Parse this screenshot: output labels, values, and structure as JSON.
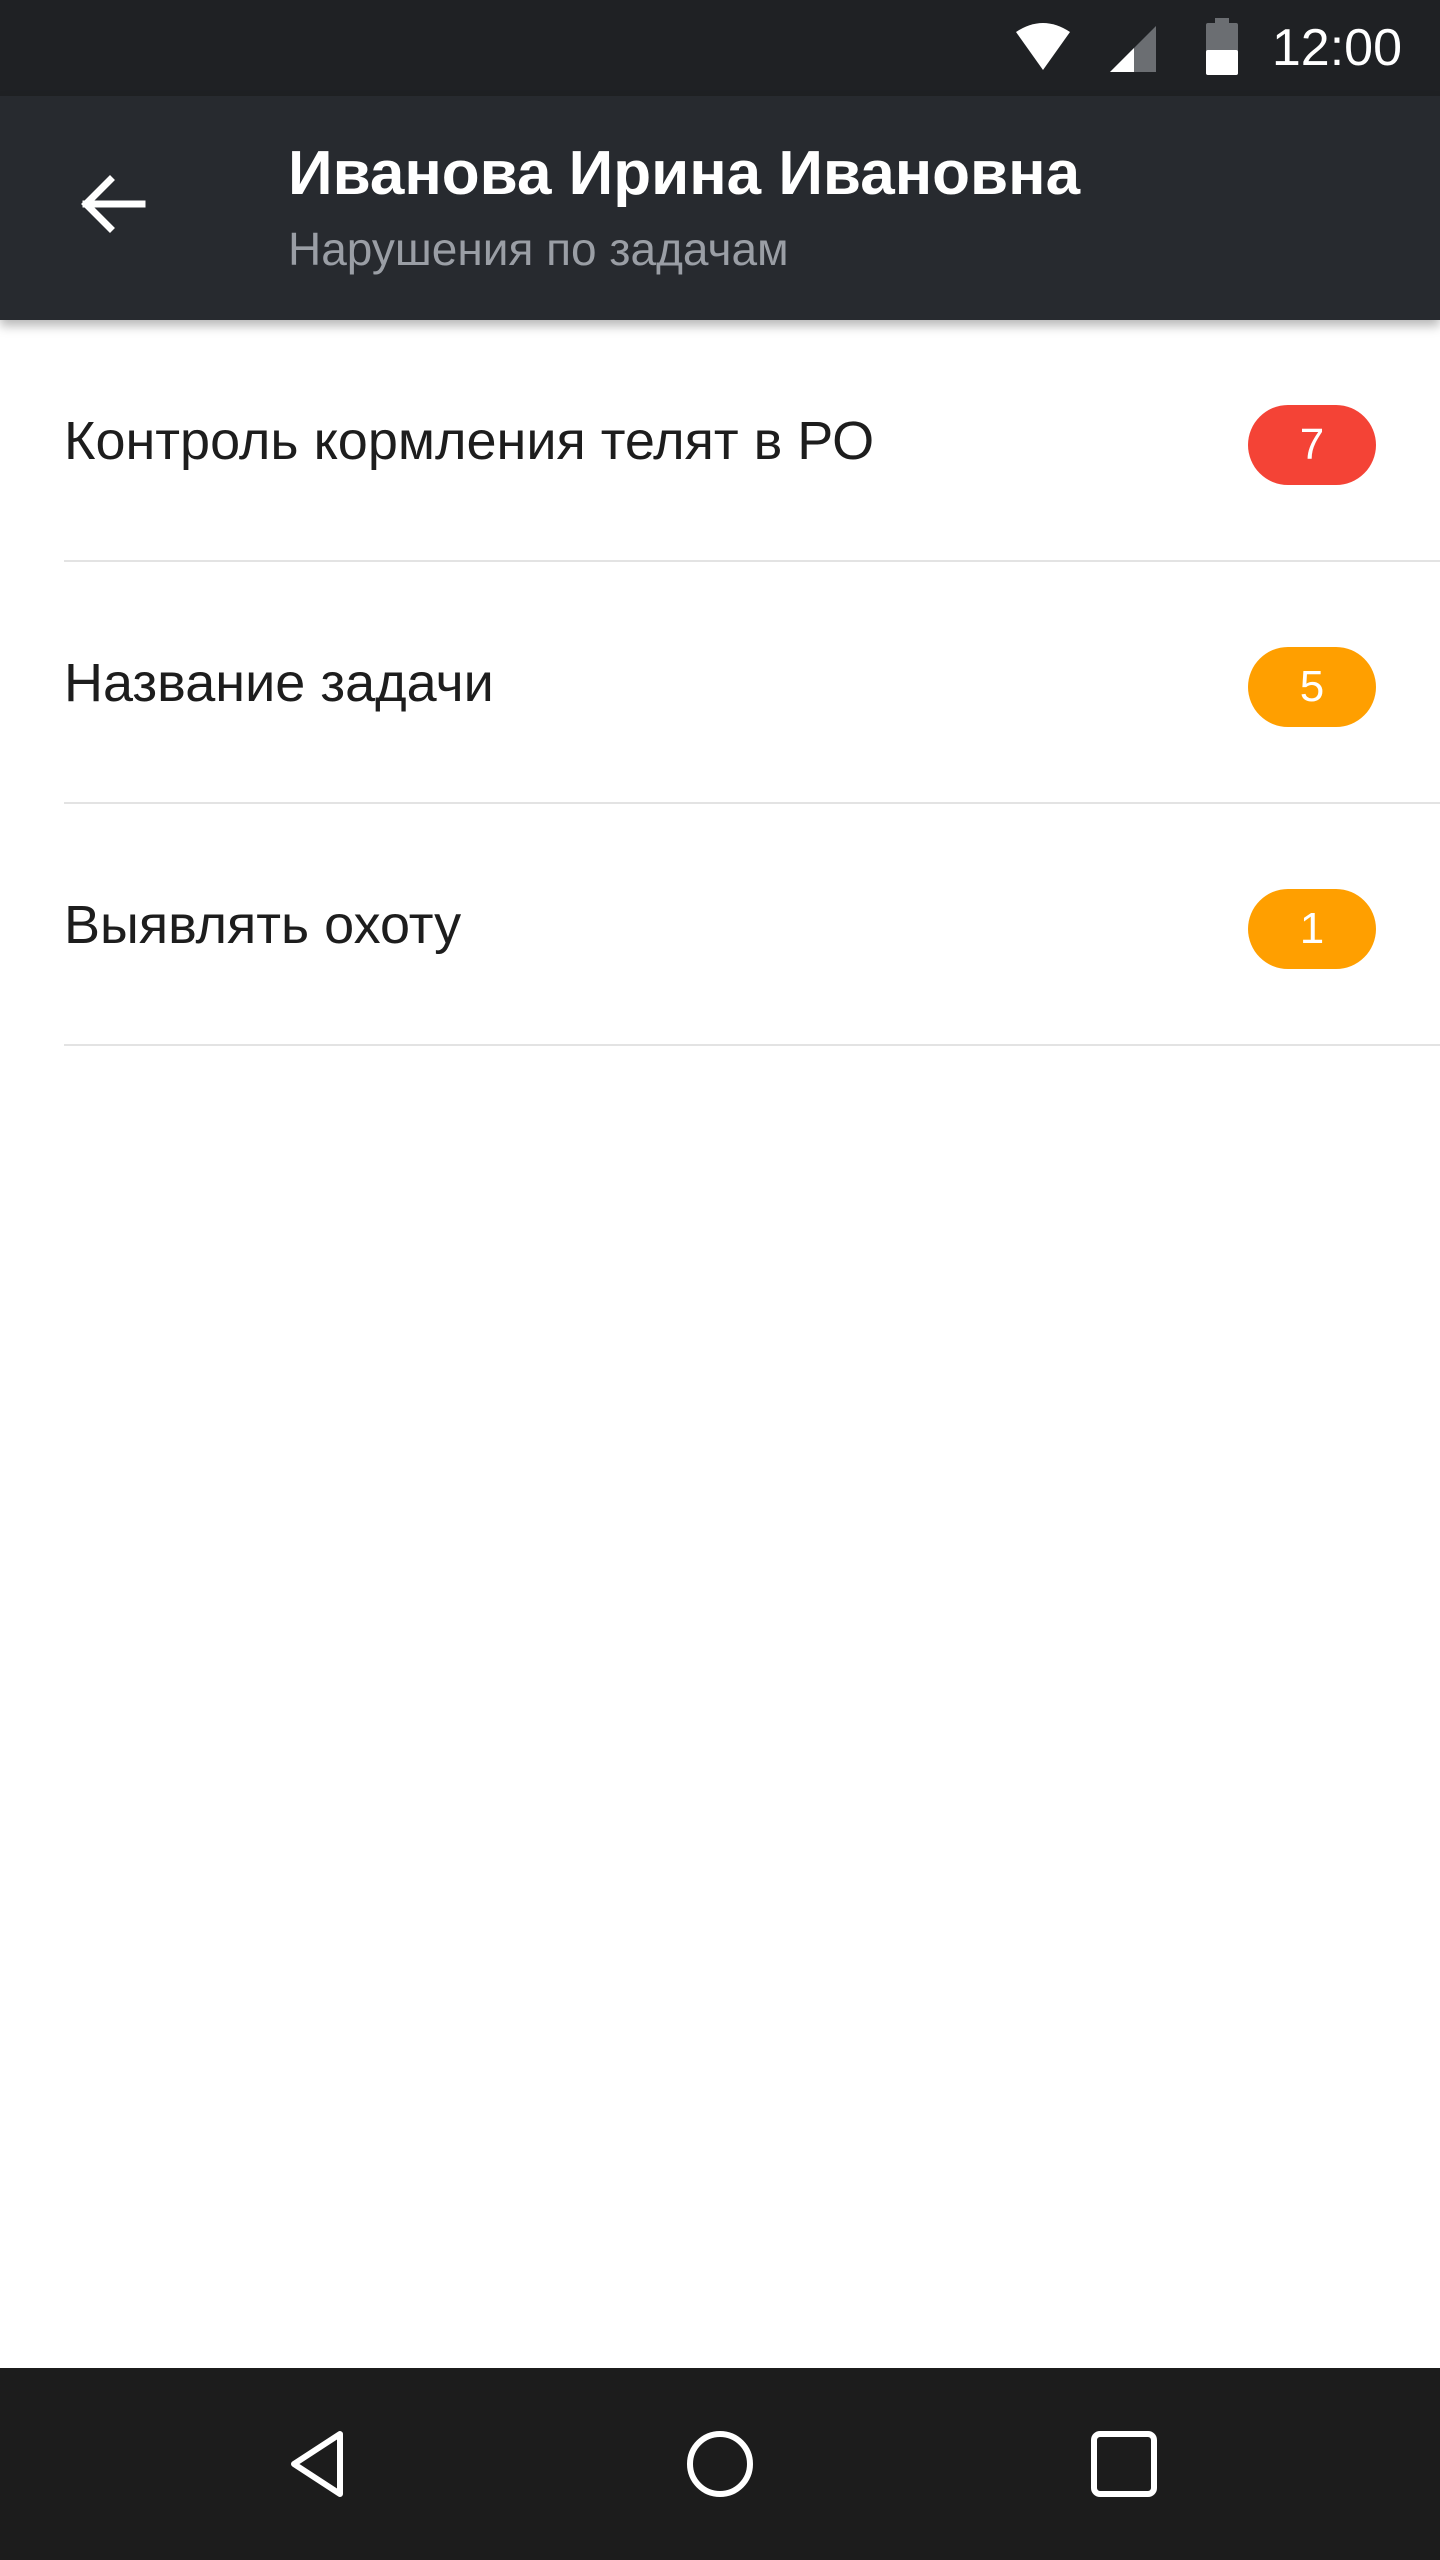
{
  "status_bar": {
    "time": "12:00",
    "icons": [
      "wifi-icon",
      "cellular-signal-icon",
      "battery-icon"
    ]
  },
  "app_bar": {
    "back_icon": "arrow-left-icon",
    "title": "Иванова Ирина Ивановна",
    "subtitle": "Нарушения по задачам"
  },
  "tasks": [
    {
      "label": "Контроль кормления телят в РО",
      "count": "7",
      "badge_color": "#f44336"
    },
    {
      "label": "Название задачи",
      "count": "5",
      "badge_color": "#ff9f00"
    },
    {
      "label": "Выявлять охоту",
      "count": "1",
      "badge_color": "#ff9f00"
    }
  ],
  "nav_bar": {
    "icons": [
      "nav-back-icon",
      "nav-home-icon",
      "nav-recents-icon"
    ]
  },
  "colors": {
    "status_bar": "#1f2124",
    "app_bar": "#272a2f",
    "nav_bar": "#1c1c1c",
    "badge_red": "#f44336",
    "badge_orange": "#ff9f00"
  }
}
